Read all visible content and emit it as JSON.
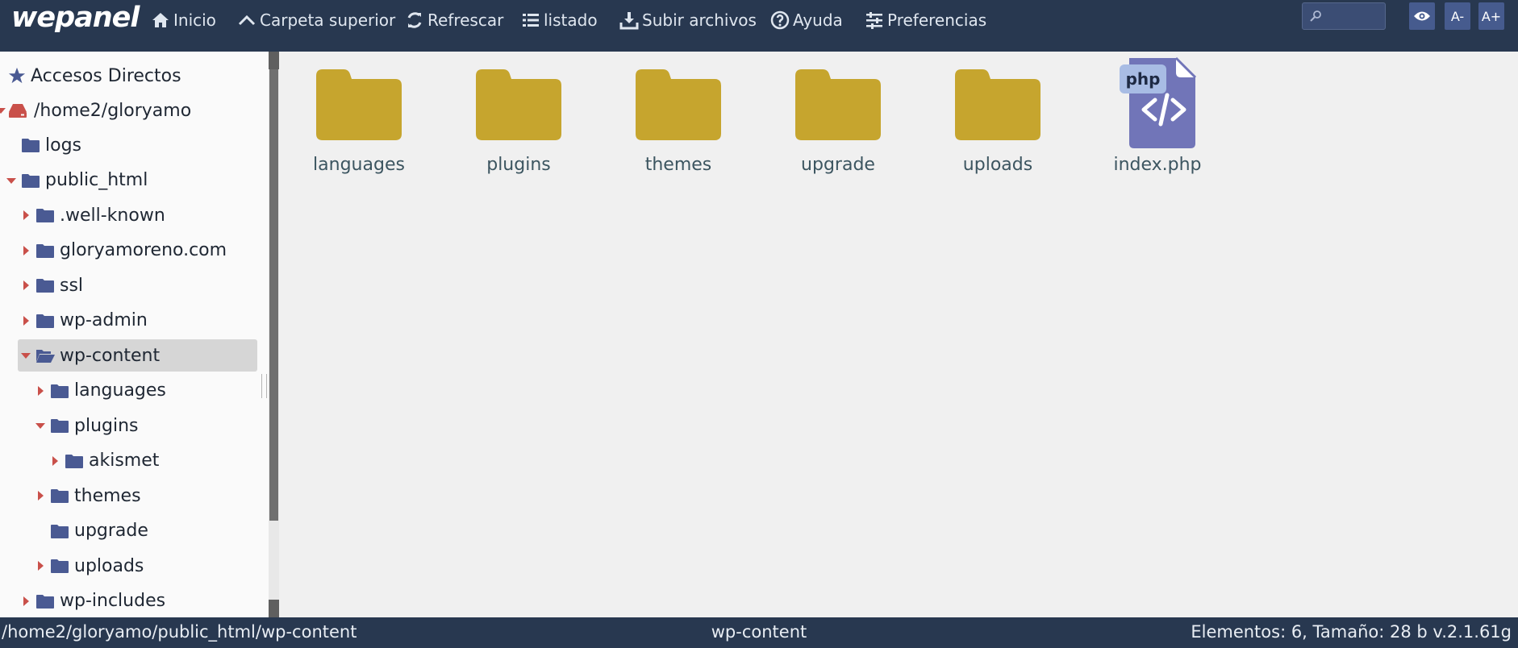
{
  "app": {
    "brand": "wepanel"
  },
  "toolbar": {
    "items": [
      {
        "label": "Inicio",
        "icon": "home-icon"
      },
      {
        "label": "Carpeta superior",
        "icon": "chevron-up-icon"
      },
      {
        "label": "Refrescar",
        "icon": "refresh-icon"
      },
      {
        "label": "listado",
        "icon": "list-icon"
      },
      {
        "label": "Subir archivos",
        "icon": "upload-icon"
      },
      {
        "label": "Ayuda",
        "icon": "help-icon"
      },
      {
        "label": "Preferencias",
        "icon": "sliders-icon"
      }
    ],
    "search_placeholder": "",
    "font_decrease": "A-",
    "font_increase": "A+"
  },
  "sidebar": {
    "shortcuts_label": "Accesos Directos",
    "root_label": "/home2/gloryamo",
    "tree": [
      {
        "label": "logs",
        "caret": "none"
      },
      {
        "label": "public_html",
        "caret": "down"
      },
      {
        "label": ".well-known",
        "caret": "right"
      },
      {
        "label": "gloryamoreno.com",
        "caret": "right"
      },
      {
        "label": "ssl",
        "caret": "right"
      },
      {
        "label": "wp-admin",
        "caret": "right"
      },
      {
        "label": "wp-content",
        "caret": "down",
        "selected": true
      },
      {
        "label": "languages",
        "caret": "right"
      },
      {
        "label": "plugins",
        "caret": "down"
      },
      {
        "label": "akismet",
        "caret": "right"
      },
      {
        "label": "themes",
        "caret": "right"
      },
      {
        "label": "upgrade",
        "caret": "none"
      },
      {
        "label": "uploads",
        "caret": "right"
      },
      {
        "label": "wp-includes",
        "caret": "right"
      }
    ]
  },
  "main": {
    "items": [
      {
        "label": "languages",
        "type": "folder"
      },
      {
        "label": "plugins",
        "type": "folder"
      },
      {
        "label": "themes",
        "type": "folder"
      },
      {
        "label": "upgrade",
        "type": "folder"
      },
      {
        "label": "uploads",
        "type": "folder"
      },
      {
        "label": "index.php",
        "type": "php",
        "badge": "php"
      }
    ]
  },
  "statusbar": {
    "path": "/home2/gloryamo/public_html/wp-content",
    "folder": "wp-content",
    "info": "Elementos: 6, Tamaño: 28 b v.2.1.61g"
  },
  "colors": {
    "toolbar_bg": "#283850",
    "folder_main": "#c6a52e",
    "folder_tree": "#4a5a93",
    "caret": "#c9504a",
    "php_file": "#7175b8",
    "php_badge": "#a8bce4"
  }
}
